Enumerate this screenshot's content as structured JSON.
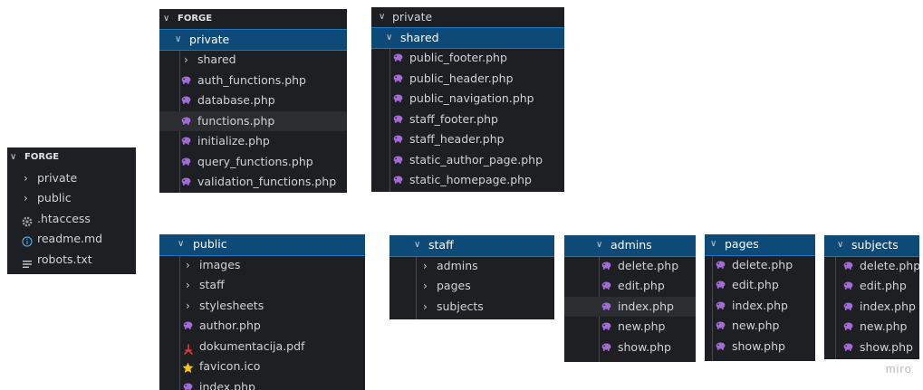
{
  "icons": {
    "php": "elephant-php-icon",
    "folder_closed": "chevron-right-icon",
    "folder_open": "chevron-down-icon",
    "gear": "gear-icon",
    "info": "info-icon",
    "lines": "text-lines-icon",
    "pdf": "pdf-icon",
    "star": "star-icon"
  },
  "colors": {
    "php_icon": "#a36ad8",
    "selected_bg": "#0e4a77",
    "panel_bg": "#1e1f23",
    "pdf_icon": "#e53935",
    "star_icon": "#f5c518"
  },
  "forge_root": {
    "items": [
      "FORGE",
      "private",
      "public",
      ".htaccess",
      "readme.md",
      "robots.txt"
    ]
  },
  "forge_private": {
    "items": [
      "FORGE",
      "private",
      "shared",
      "auth_functions.php",
      "database.php",
      "functions.php",
      "initialize.php",
      "query_functions.php",
      "validation_functions.php"
    ]
  },
  "private_shared": {
    "items": [
      "private",
      "shared",
      "public_footer.php",
      "public_header.php",
      "public_navigation.php",
      "staff_footer.php",
      "staff_header.php",
      "static_author_page.php",
      "static_homepage.php"
    ]
  },
  "public_tree": {
    "items": [
      "public",
      "images",
      "staff",
      "stylesheets",
      "author.php",
      "dokumentacija.pdf",
      "favicon.ico",
      "index.php"
    ]
  },
  "staff_tree": {
    "items": [
      "staff",
      "admins",
      "pages",
      "subjects"
    ]
  },
  "admins_tree": {
    "items": [
      "admins",
      "delete.php",
      "edit.php",
      "index.php",
      "new.php",
      "show.php"
    ]
  },
  "pages_tree": {
    "items": [
      "pages",
      "delete.php",
      "edit.php",
      "index.php",
      "new.php",
      "show.php"
    ]
  },
  "subjects_tree": {
    "items": [
      "subjects",
      "delete.php",
      "edit.php",
      "index.php",
      "new.php",
      "show.php"
    ]
  },
  "watermark": "miro"
}
